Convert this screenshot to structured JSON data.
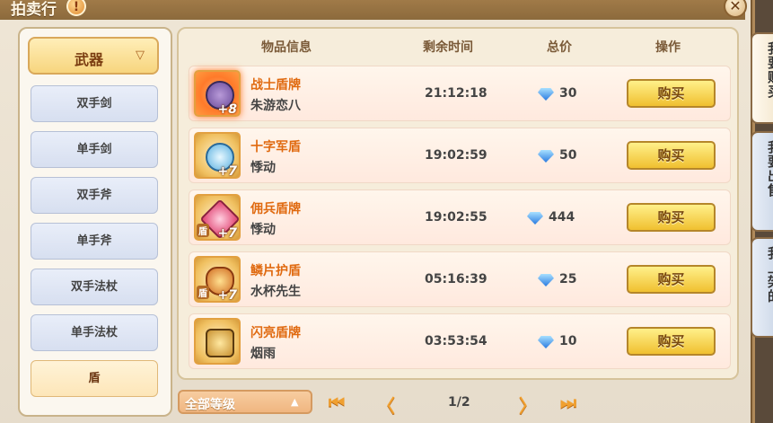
{
  "window": {
    "title": "拍卖行",
    "help_icon": "!",
    "close_icon": "✕"
  },
  "side_tabs": [
    "我要购买",
    "我要出售",
    "我上架的"
  ],
  "category": {
    "current": "武器",
    "items": [
      "双手剑",
      "单手剑",
      "双手斧",
      "单手斧",
      "双手法杖",
      "单手法杖",
      "盾"
    ],
    "selected": "盾"
  },
  "columns": {
    "item": "物品信息",
    "time": "剩余时间",
    "price": "总价",
    "action": "操作"
  },
  "listings": [
    {
      "name": "战士盾牌",
      "seller": "朱游恋八",
      "time": "21:12:18",
      "price": "30",
      "level": "+8",
      "tag": ""
    },
    {
      "name": "十字军盾",
      "seller": "悸动",
      "time": "19:02:59",
      "price": "50",
      "level": "+7",
      "tag": ""
    },
    {
      "name": "佣兵盾牌",
      "seller": "悸动",
      "time": "19:02:55",
      "price": "444",
      "level": "+7",
      "tag": "盾"
    },
    {
      "name": "鳞片护盾",
      "seller": "水杯先生",
      "time": "05:16:39",
      "price": "25",
      "level": "+7",
      "tag": "盾"
    },
    {
      "name": "闪亮盾牌",
      "seller": "烟雨",
      "time": "03:53:54",
      "price": "10",
      "level": "",
      "tag": ""
    }
  ],
  "buy_label": "购买",
  "filter": {
    "level": "全部等级"
  },
  "pager": {
    "first": "⏮",
    "prev": "〈",
    "page": "1/2",
    "next": "〉",
    "last": "⏭"
  },
  "colors": {
    "accent": "#f0c030",
    "item_name": "#e06a10",
    "gem": "#2a7ae0"
  }
}
